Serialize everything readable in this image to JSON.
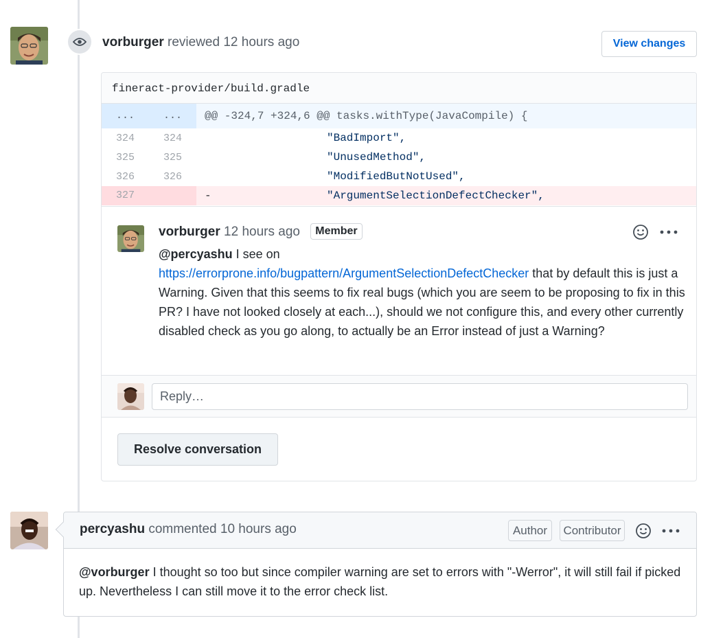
{
  "review": {
    "author": "vorburger",
    "action": "reviewed",
    "time": "12 hours ago",
    "view_changes_label": "View changes"
  },
  "file": {
    "path": "fineract-provider/build.gradle",
    "hunk": {
      "left": "...",
      "right": "...",
      "header": "@@ -324,7 +324,6 @@ tasks.withType(JavaCompile) {"
    },
    "lines": [
      {
        "left": "324",
        "right": "324",
        "marker": "",
        "code": "\"BadImport\","
      },
      {
        "left": "325",
        "right": "325",
        "marker": "",
        "code": "\"UnusedMethod\","
      },
      {
        "left": "326",
        "right": "326",
        "marker": "",
        "code": "\"ModifiedButNotUsed\","
      },
      {
        "left": "327",
        "right": "",
        "marker": "-",
        "code": "\"ArgumentSelectionDefectChecker\","
      }
    ]
  },
  "review_comment": {
    "author": "vorburger",
    "time": "12 hours ago",
    "badge": "Member",
    "mention": "@percyashu",
    "text_before_link": " I see on",
    "link": "https://errorprone.info/bugpattern/ArgumentSelectionDefectChecker",
    "text_after_link": " that by default this is just a Warning. Given that this seems to fix real bugs (which you are seem to be proposing to fix in this PR? I have not looked closely at each...), should we not configure this, and every other currently disabled check as you go along, to actually be an Error instead of just a Warning?"
  },
  "reply": {
    "placeholder": "Reply…"
  },
  "resolve_label": "Resolve conversation",
  "comment2": {
    "author": "percyashu",
    "action": "commented",
    "time": "10 hours ago",
    "badge_author": "Author",
    "badge_contributor": "Contributor",
    "mention": "@vorburger",
    "text": " I thought so too but since compiler warning are set to errors with \"-Werror\", it will still fail if picked up. Nevertheless I can still move it to the error check list."
  },
  "colors": {
    "link": "#0366d6",
    "deletion_bg": "#ffeef0",
    "hunk_bg": "#f1f8ff"
  }
}
